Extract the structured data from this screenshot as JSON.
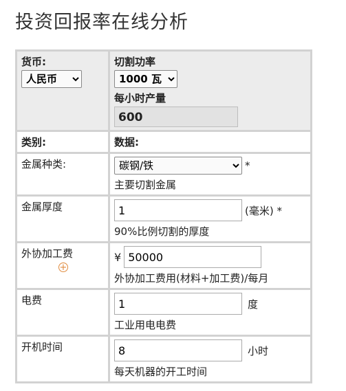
{
  "page": {
    "title": "投资回报率在线分析"
  },
  "currency": {
    "label": "货币:",
    "selected": "人民币"
  },
  "cutting_power": {
    "label": "切割功率",
    "selected": "1000 瓦"
  },
  "hourly_output": {
    "label": "每小时产量",
    "value": "600"
  },
  "headers": {
    "category": "类别:",
    "data": "数据:"
  },
  "rows": {
    "metal_type": {
      "label": "金属种类:",
      "selected": "碳钢/铁",
      "required": "*",
      "hint": "主要切割金属"
    },
    "thickness": {
      "label": "金属厚度",
      "value": "1",
      "unit": "(毫米) *",
      "hint": "90%比例切割的厚度"
    },
    "outsourcing": {
      "label": "外协加工费",
      "currency_symbol": "¥",
      "value": "50000",
      "hint": "外协加工费用(材料+加工费)/每月",
      "add_icon": "plus-circle-icon"
    },
    "electricity": {
      "label": "电费",
      "value": "1",
      "unit": "度",
      "hint": "工业用电电费"
    },
    "hours": {
      "label": "开机时间",
      "value": "8",
      "unit": "小时",
      "hint": "每天机器的开工时间"
    }
  },
  "colors": {
    "table_border": "#d2d2d2",
    "accent_icon": "#e08a3c",
    "readonly_bg": "#e2e2e2"
  }
}
